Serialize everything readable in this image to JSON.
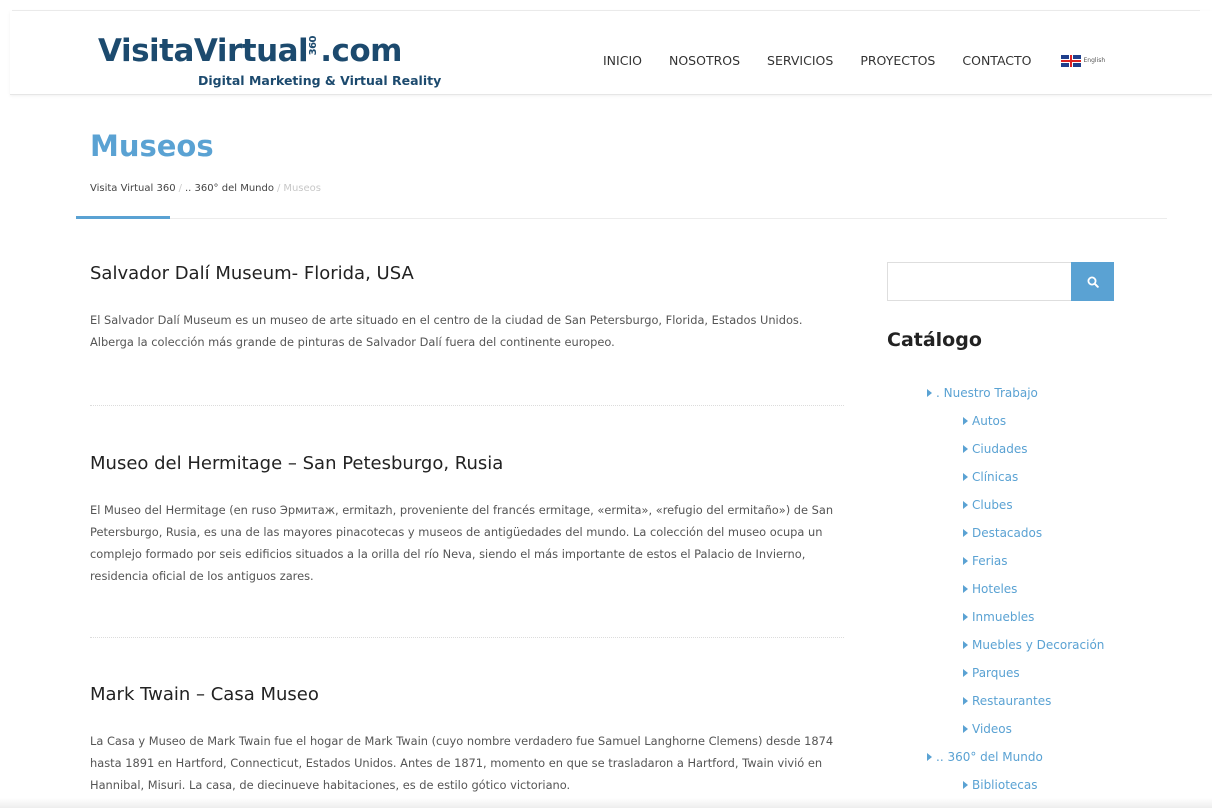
{
  "logo": {
    "main_before": "VisitaVirtual",
    "rotated": "360",
    "main_after": ".com",
    "tagline": "Digital Marketing & Virtual Reality"
  },
  "nav": {
    "items": [
      "INICIO",
      "NOSOTROS",
      "SERVICIOS",
      "PROYECTOS",
      "CONTACTO"
    ],
    "language": "English"
  },
  "page": {
    "title": "Museos",
    "breadcrumb": [
      "Visita Virtual 360",
      ".. 360° del Mundo",
      "Museos"
    ],
    "breadcrumb_sep": "/"
  },
  "articles": [
    {
      "title": "Salvador Dalí Museum- Florida, USA",
      "body": "El Salvador Dalí Museum es un museo de arte situado en el centro de la ciudad de San Petersburgo, Florida, Estados Unidos. Alberga la colección más grande de pinturas de Salvador Dalí fuera del continente europeo."
    },
    {
      "title": "Museo del Hermitage – San Petesburgo, Rusia",
      "body": "El Museo del Hermitage (en ruso Эрмитаж, ermitazh, proveniente del francés ermitage, «ermita», «refugio del ermitaño») de San Petersburgo, Rusia, es una de las mayores pinacotecas y museos de antigüedades del mundo. La colección del museo ocupa un complejo formado por seis edificios situados a la orilla del río Neva, siendo el más importante de estos el Palacio de Invierno, residencia oficial de los antiguos zares."
    },
    {
      "title": "Mark Twain – Casa Museo",
      "body": "La Casa y Museo de Mark Twain fue el hogar de Mark Twain (cuyo nombre verdadero fue Samuel Langhorne Clemens) desde 1874 hasta 1891 en Hartford, Connecticut, Estados Unidos. Antes de 1871, momento en que se trasladaron a Hartford, Twain vivió en Hannibal, Misuri. La casa, de diecinueve habitaciones, es de estilo gótico victoriano."
    }
  ],
  "sidebar": {
    "search_placeholder": "",
    "search_icon": "search-icon",
    "catalog_title": "Catálogo",
    "catalog": [
      {
        "label": ". Nuestro Trabajo",
        "level": 0
      },
      {
        "label": "Autos",
        "level": 1
      },
      {
        "label": "Ciudades",
        "level": 1
      },
      {
        "label": "Clínicas",
        "level": 1
      },
      {
        "label": "Clubes",
        "level": 1
      },
      {
        "label": "Destacados",
        "level": 1
      },
      {
        "label": "Ferias",
        "level": 1
      },
      {
        "label": "Hoteles",
        "level": 1
      },
      {
        "label": "Inmuebles",
        "level": 1
      },
      {
        "label": "Muebles y Decoración",
        "level": 1
      },
      {
        "label": "Parques",
        "level": 1
      },
      {
        "label": "Restaurantes",
        "level": 1
      },
      {
        "label": "Videos",
        "level": 1
      },
      {
        "label": ".. 360° del Mundo",
        "level": 0
      },
      {
        "label": "Bibliotecas",
        "level": 1
      }
    ]
  },
  "colors": {
    "accent": "#5aa2d3",
    "logo": "#1c4a6e"
  }
}
